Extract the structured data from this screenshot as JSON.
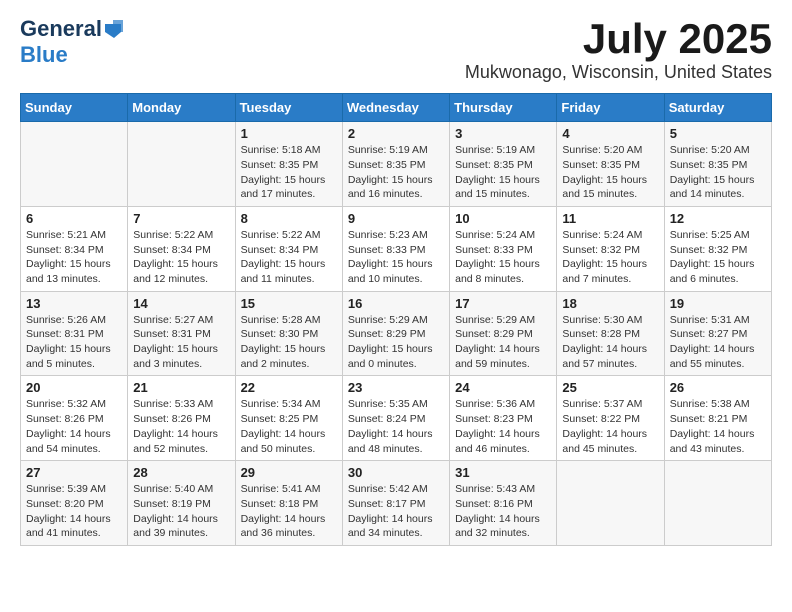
{
  "header": {
    "logo_line1": "General",
    "logo_line2": "Blue",
    "title": "July 2025",
    "subtitle": "Mukwonago, Wisconsin, United States"
  },
  "calendar": {
    "days_of_week": [
      "Sunday",
      "Monday",
      "Tuesday",
      "Wednesday",
      "Thursday",
      "Friday",
      "Saturday"
    ],
    "weeks": [
      [
        {
          "day": "",
          "content": ""
        },
        {
          "day": "",
          "content": ""
        },
        {
          "day": "1",
          "content": "Sunrise: 5:18 AM\nSunset: 8:35 PM\nDaylight: 15 hours and 17 minutes."
        },
        {
          "day": "2",
          "content": "Sunrise: 5:19 AM\nSunset: 8:35 PM\nDaylight: 15 hours and 16 minutes."
        },
        {
          "day": "3",
          "content": "Sunrise: 5:19 AM\nSunset: 8:35 PM\nDaylight: 15 hours and 15 minutes."
        },
        {
          "day": "4",
          "content": "Sunrise: 5:20 AM\nSunset: 8:35 PM\nDaylight: 15 hours and 15 minutes."
        },
        {
          "day": "5",
          "content": "Sunrise: 5:20 AM\nSunset: 8:35 PM\nDaylight: 15 hours and 14 minutes."
        }
      ],
      [
        {
          "day": "6",
          "content": "Sunrise: 5:21 AM\nSunset: 8:34 PM\nDaylight: 15 hours and 13 minutes."
        },
        {
          "day": "7",
          "content": "Sunrise: 5:22 AM\nSunset: 8:34 PM\nDaylight: 15 hours and 12 minutes."
        },
        {
          "day": "8",
          "content": "Sunrise: 5:22 AM\nSunset: 8:34 PM\nDaylight: 15 hours and 11 minutes."
        },
        {
          "day": "9",
          "content": "Sunrise: 5:23 AM\nSunset: 8:33 PM\nDaylight: 15 hours and 10 minutes."
        },
        {
          "day": "10",
          "content": "Sunrise: 5:24 AM\nSunset: 8:33 PM\nDaylight: 15 hours and 8 minutes."
        },
        {
          "day": "11",
          "content": "Sunrise: 5:24 AM\nSunset: 8:32 PM\nDaylight: 15 hours and 7 minutes."
        },
        {
          "day": "12",
          "content": "Sunrise: 5:25 AM\nSunset: 8:32 PM\nDaylight: 15 hours and 6 minutes."
        }
      ],
      [
        {
          "day": "13",
          "content": "Sunrise: 5:26 AM\nSunset: 8:31 PM\nDaylight: 15 hours and 5 minutes."
        },
        {
          "day": "14",
          "content": "Sunrise: 5:27 AM\nSunset: 8:31 PM\nDaylight: 15 hours and 3 minutes."
        },
        {
          "day": "15",
          "content": "Sunrise: 5:28 AM\nSunset: 8:30 PM\nDaylight: 15 hours and 2 minutes."
        },
        {
          "day": "16",
          "content": "Sunrise: 5:29 AM\nSunset: 8:29 PM\nDaylight: 15 hours and 0 minutes."
        },
        {
          "day": "17",
          "content": "Sunrise: 5:29 AM\nSunset: 8:29 PM\nDaylight: 14 hours and 59 minutes."
        },
        {
          "day": "18",
          "content": "Sunrise: 5:30 AM\nSunset: 8:28 PM\nDaylight: 14 hours and 57 minutes."
        },
        {
          "day": "19",
          "content": "Sunrise: 5:31 AM\nSunset: 8:27 PM\nDaylight: 14 hours and 55 minutes."
        }
      ],
      [
        {
          "day": "20",
          "content": "Sunrise: 5:32 AM\nSunset: 8:26 PM\nDaylight: 14 hours and 54 minutes."
        },
        {
          "day": "21",
          "content": "Sunrise: 5:33 AM\nSunset: 8:26 PM\nDaylight: 14 hours and 52 minutes."
        },
        {
          "day": "22",
          "content": "Sunrise: 5:34 AM\nSunset: 8:25 PM\nDaylight: 14 hours and 50 minutes."
        },
        {
          "day": "23",
          "content": "Sunrise: 5:35 AM\nSunset: 8:24 PM\nDaylight: 14 hours and 48 minutes."
        },
        {
          "day": "24",
          "content": "Sunrise: 5:36 AM\nSunset: 8:23 PM\nDaylight: 14 hours and 46 minutes."
        },
        {
          "day": "25",
          "content": "Sunrise: 5:37 AM\nSunset: 8:22 PM\nDaylight: 14 hours and 45 minutes."
        },
        {
          "day": "26",
          "content": "Sunrise: 5:38 AM\nSunset: 8:21 PM\nDaylight: 14 hours and 43 minutes."
        }
      ],
      [
        {
          "day": "27",
          "content": "Sunrise: 5:39 AM\nSunset: 8:20 PM\nDaylight: 14 hours and 41 minutes."
        },
        {
          "day": "28",
          "content": "Sunrise: 5:40 AM\nSunset: 8:19 PM\nDaylight: 14 hours and 39 minutes."
        },
        {
          "day": "29",
          "content": "Sunrise: 5:41 AM\nSunset: 8:18 PM\nDaylight: 14 hours and 36 minutes."
        },
        {
          "day": "30",
          "content": "Sunrise: 5:42 AM\nSunset: 8:17 PM\nDaylight: 14 hours and 34 minutes."
        },
        {
          "day": "31",
          "content": "Sunrise: 5:43 AM\nSunset: 8:16 PM\nDaylight: 14 hours and 32 minutes."
        },
        {
          "day": "",
          "content": ""
        },
        {
          "day": "",
          "content": ""
        }
      ]
    ]
  }
}
